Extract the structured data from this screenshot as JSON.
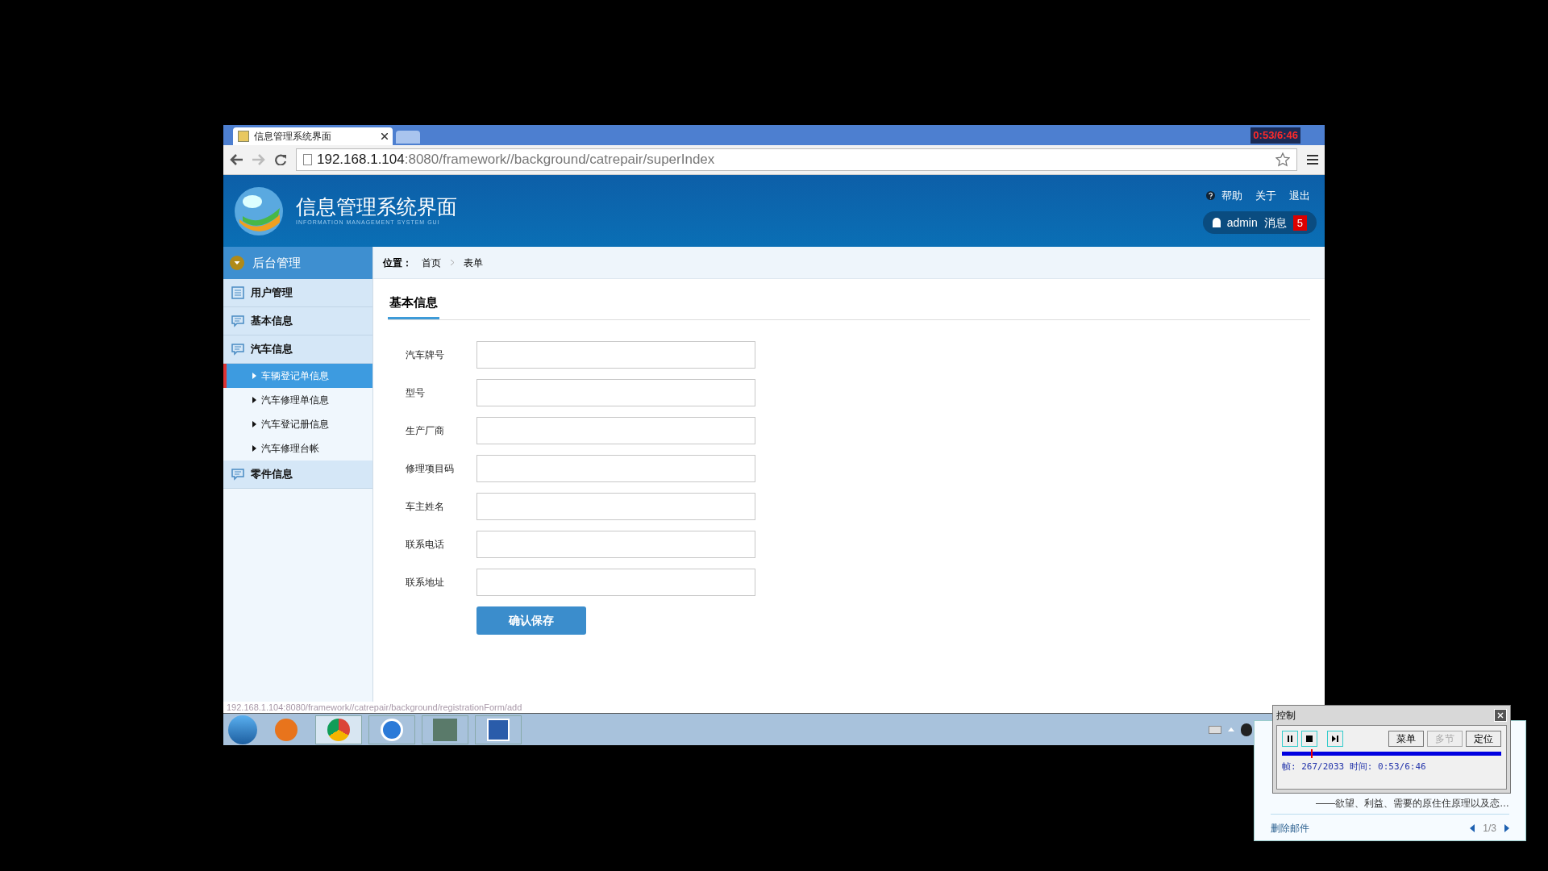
{
  "browser": {
    "tab_title": "信息管理系统界面",
    "url_host": "192.168.1.104",
    "url_rest": ":8080/framework//background/catrepair/superIndex",
    "status_url": "192.168.1.104:8080/framework//catrepair/background/registrationForm/add"
  },
  "recording_timer": "0:53/6:46",
  "header": {
    "title": "信息管理系统界面",
    "subtitle": "INFORMATION MANAGEMENT SYSTEM GUI",
    "links": [
      "帮助",
      "关于",
      "退出"
    ],
    "user": "admin",
    "messages_label": "消息",
    "messages_count": "5"
  },
  "sidebar": {
    "title": "后台管理",
    "sections": [
      {
        "label": "用户管理",
        "kind": "list"
      },
      {
        "label": "基本信息",
        "kind": "message"
      },
      {
        "label": "汽车信息",
        "kind": "message",
        "children": [
          {
            "label": "车辆登记单信息",
            "selected": true
          },
          {
            "label": "汽车修理单信息",
            "selected": false
          },
          {
            "label": "汽车登记册信息",
            "selected": false
          },
          {
            "label": "汽车修理台帐",
            "selected": false
          }
        ]
      },
      {
        "label": "零件信息",
        "kind": "message"
      }
    ]
  },
  "breadcrumb": {
    "label": "位置：",
    "items": [
      "首页",
      "表单"
    ]
  },
  "form": {
    "tab": "基本信息",
    "fields": [
      {
        "label": "汽车牌号"
      },
      {
        "label": "型号"
      },
      {
        "label": "生产厂商"
      },
      {
        "label": "修理项目码"
      },
      {
        "label": "车主姓名"
      },
      {
        "label": "联系电话"
      },
      {
        "label": "联系地址"
      }
    ],
    "submit": "确认保存"
  },
  "notification": {
    "text": "——欲望、利益、需要的原住住原理以及恋…",
    "action": "删除邮件",
    "pager": "1/3"
  },
  "control_window": {
    "title": "控制",
    "buttons": [
      {
        "label": "菜单",
        "disabled": false
      },
      {
        "label": "多节",
        "disabled": true
      },
      {
        "label": "定位",
        "disabled": false
      }
    ],
    "level": 0.131,
    "status": "帧: 267/2033 时间: 0:53/6:46"
  }
}
